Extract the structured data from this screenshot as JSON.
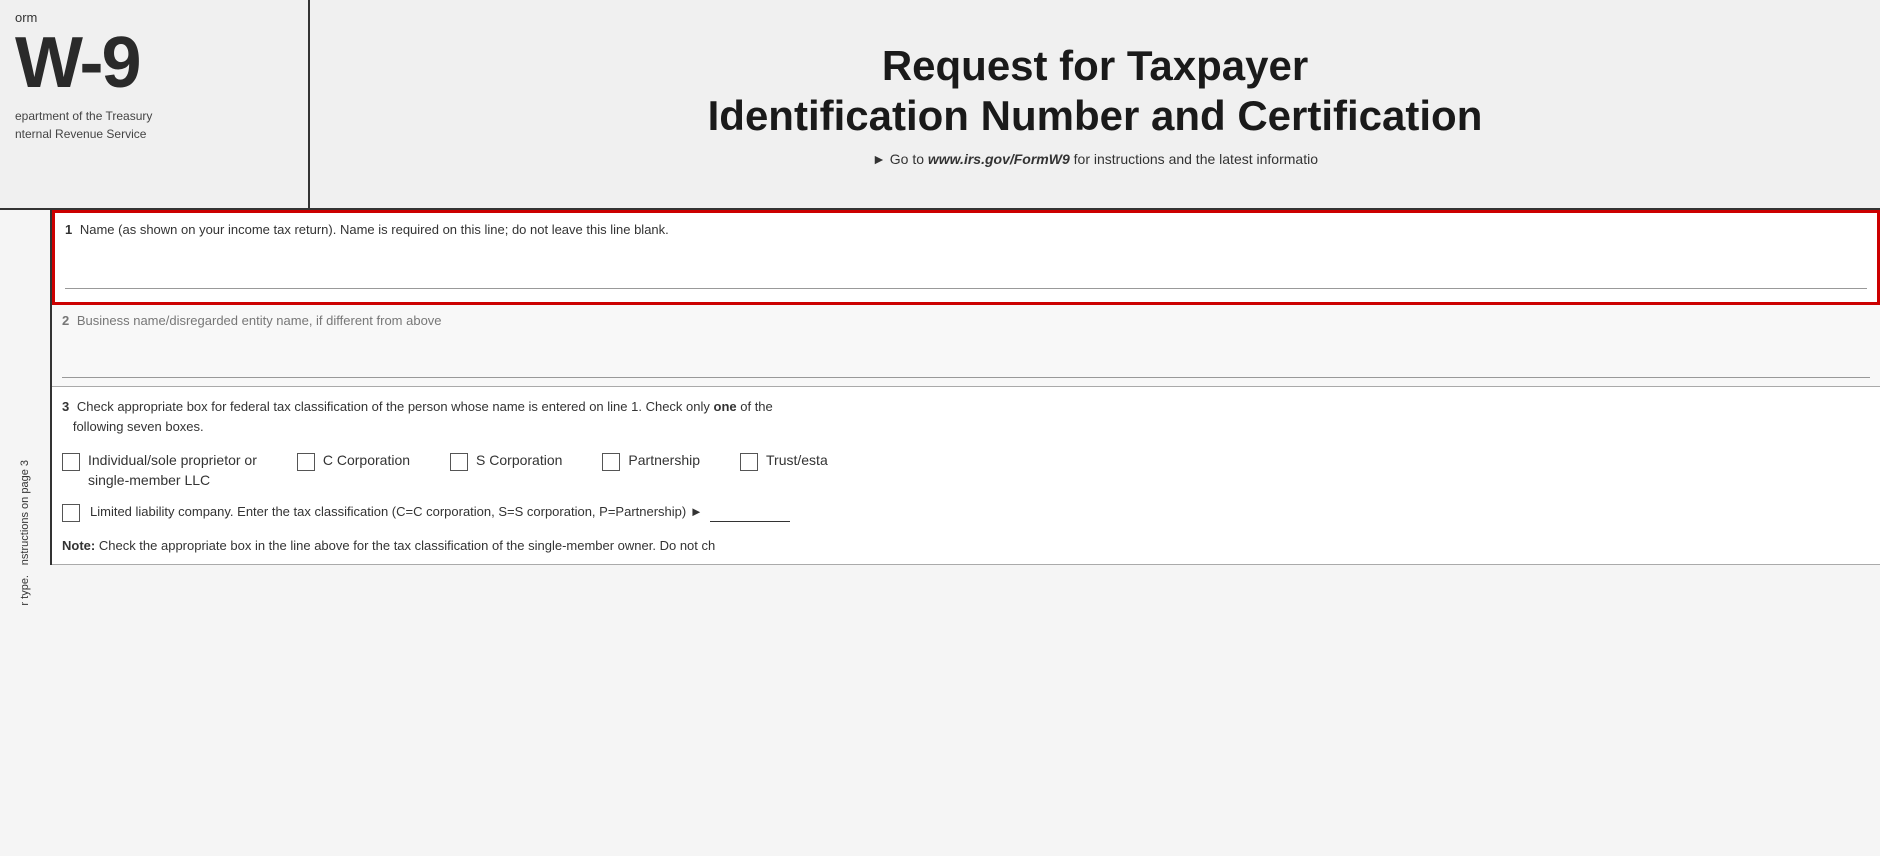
{
  "header": {
    "form_label": "orm",
    "form_number": "W-9",
    "department_line1": "epartment of the Treasury",
    "department_line2": "nternal Revenue Service",
    "title_line1": "Request for Taxpayer",
    "title_line2": "Identification Number and Certification",
    "url_text": "► Go to ",
    "url_link": "www.irs.gov/FormW9",
    "url_suffix": " for instructions and the latest informatio"
  },
  "side_labels": {
    "line1": "r type.",
    "line2": "nstructions on page 3"
  },
  "fields": {
    "field1": {
      "number": "1",
      "label": "Name (as shown on your income tax return). Name is required on this line; do not leave this line blank."
    },
    "field2": {
      "number": "2",
      "label": "Business name/disregarded entity name, if different from above"
    },
    "field3": {
      "number": "3",
      "intro": "Check appropriate box for federal tax classification of the person whose name is entered on line 1. Check only ",
      "intro_bold": "one",
      "intro_suffix": " of the",
      "intro2": "following seven boxes.",
      "checkboxes": [
        {
          "id": "individual",
          "label": "Individual/sole proprietor or\nsingle-member LLC",
          "checked": false
        },
        {
          "id": "c_corp",
          "label": "C Corporation",
          "checked": false
        },
        {
          "id": "s_corp",
          "label": "S Corporation",
          "checked": false
        },
        {
          "id": "partnership",
          "label": "Partnership",
          "checked": false
        },
        {
          "id": "trust",
          "label": "Trust/esta",
          "checked": false
        }
      ],
      "llc_label": "Limited liability company. Enter the tax classification (C=C corporation, S=S corporation, P=Partnership)",
      "llc_arrow": "►",
      "note_bold": "Note:",
      "note_text": " Check the appropriate box in the line above for the tax classification of the single-member owner.  Do not ch"
    }
  }
}
